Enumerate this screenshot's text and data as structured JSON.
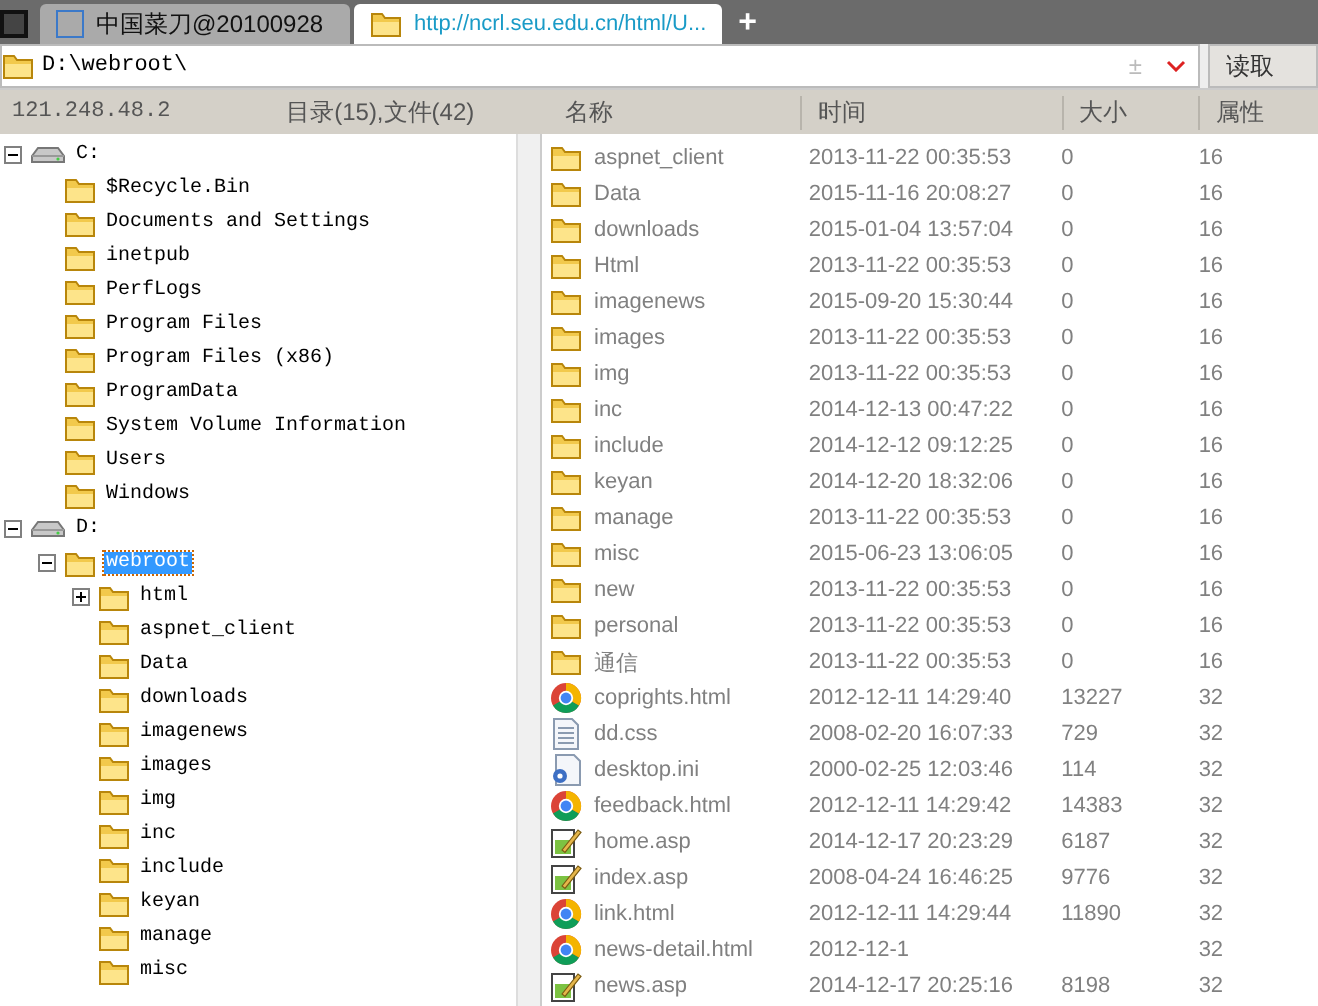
{
  "tabs": [
    {
      "label": "中国菜刀@20100928",
      "selected": false
    },
    {
      "label": "http://ncrl.seu.edu.cn/html/U...",
      "selected": true
    }
  ],
  "new_tab": "+",
  "address_bar": {
    "value": "D:\\webroot\\",
    "toggle": "±",
    "button": "读取"
  },
  "status": {
    "host": "121.248.48.2",
    "counts": "目录(15),文件(42)"
  },
  "columns": [
    "名称",
    "时间",
    "大小",
    "属性"
  ],
  "tree": [
    {
      "label": "C:",
      "kind": "drive",
      "expanded": true,
      "selected": false,
      "children": [
        {
          "label": "$Recycle.Bin",
          "kind": "folder",
          "selected": false
        },
        {
          "label": "Documents and Settings",
          "kind": "folder",
          "selected": false
        },
        {
          "label": "inetpub",
          "kind": "folder",
          "selected": false
        },
        {
          "label": "PerfLogs",
          "kind": "folder",
          "selected": false
        },
        {
          "label": "Program Files",
          "kind": "folder",
          "selected": false
        },
        {
          "label": "Program Files (x86)",
          "kind": "folder",
          "selected": false
        },
        {
          "label": "ProgramData",
          "kind": "folder",
          "selected": false
        },
        {
          "label": "System Volume Information",
          "kind": "folder",
          "selected": false
        },
        {
          "label": "Users",
          "kind": "folder",
          "selected": false
        },
        {
          "label": "Windows",
          "kind": "folder",
          "selected": false
        }
      ]
    },
    {
      "label": "D:",
      "kind": "drive",
      "expanded": true,
      "selected": false,
      "children": [
        {
          "label": "webroot",
          "kind": "folder",
          "expanded": true,
          "selected": true,
          "children": [
            {
              "label": "html",
              "kind": "folder",
              "expanded": false,
              "selected": false
            },
            {
              "label": "aspnet_client",
              "kind": "folder",
              "selected": false
            },
            {
              "label": "Data",
              "kind": "folder",
              "selected": false
            },
            {
              "label": "downloads",
              "kind": "folder",
              "selected": false
            },
            {
              "label": "imagenews",
              "kind": "folder",
              "selected": false
            },
            {
              "label": "images",
              "kind": "folder",
              "selected": false
            },
            {
              "label": "img",
              "kind": "folder",
              "selected": false
            },
            {
              "label": "inc",
              "kind": "folder",
              "selected": false
            },
            {
              "label": "include",
              "kind": "folder",
              "selected": false
            },
            {
              "label": "keyan",
              "kind": "folder",
              "selected": false
            },
            {
              "label": "manage",
              "kind": "folder",
              "selected": false
            },
            {
              "label": "misc",
              "kind": "folder",
              "selected": false
            }
          ]
        }
      ]
    }
  ],
  "files": [
    {
      "kind": "folder",
      "name": "aspnet_client",
      "time": "2013-11-22 00:35:53",
      "size": "0",
      "attr": "16"
    },
    {
      "kind": "folder",
      "name": "Data",
      "time": "2015-11-16 20:08:27",
      "size": "0",
      "attr": "16"
    },
    {
      "kind": "folder",
      "name": "downloads",
      "time": "2015-01-04 13:57:04",
      "size": "0",
      "attr": "16"
    },
    {
      "kind": "folder",
      "name": "Html",
      "time": "2013-11-22 00:35:53",
      "size": "0",
      "attr": "16"
    },
    {
      "kind": "folder",
      "name": "imagenews",
      "time": "2015-09-20 15:30:44",
      "size": "0",
      "attr": "16"
    },
    {
      "kind": "folder",
      "name": "images",
      "time": "2013-11-22 00:35:53",
      "size": "0",
      "attr": "16"
    },
    {
      "kind": "folder",
      "name": "img",
      "time": "2013-11-22 00:35:53",
      "size": "0",
      "attr": "16"
    },
    {
      "kind": "folder",
      "name": "inc",
      "time": "2014-12-13 00:47:22",
      "size": "0",
      "attr": "16"
    },
    {
      "kind": "folder",
      "name": "include",
      "time": "2014-12-12 09:12:25",
      "size": "0",
      "attr": "16"
    },
    {
      "kind": "folder",
      "name": "keyan",
      "time": "2014-12-20 18:32:06",
      "size": "0",
      "attr": "16"
    },
    {
      "kind": "folder",
      "name": "manage",
      "time": "2013-11-22 00:35:53",
      "size": "0",
      "attr": "16"
    },
    {
      "kind": "folder",
      "name": "misc",
      "time": "2015-06-23 13:06:05",
      "size": "0",
      "attr": "16"
    },
    {
      "kind": "folder",
      "name": "new",
      "time": "2013-11-22 00:35:53",
      "size": "0",
      "attr": "16"
    },
    {
      "kind": "folder",
      "name": "personal",
      "time": "2013-11-22 00:35:53",
      "size": "0",
      "attr": "16"
    },
    {
      "kind": "folder",
      "name": "通信",
      "time": "2013-11-22 00:35:53",
      "size": "0",
      "attr": "16"
    },
    {
      "kind": "html",
      "name": "coprights.html",
      "time": "2012-12-11 14:29:40",
      "size": "13227",
      "attr": "32"
    },
    {
      "kind": "text",
      "name": "dd.css",
      "time": "2008-02-20 16:07:33",
      "size": "729",
      "attr": "32"
    },
    {
      "kind": "ini",
      "name": "desktop.ini",
      "time": "2000-02-25 12:03:46",
      "size": "114",
      "attr": "32"
    },
    {
      "kind": "html",
      "name": "feedback.html",
      "time": "2012-12-11 14:29:42",
      "size": "14383",
      "attr": "32"
    },
    {
      "kind": "asp",
      "name": "home.asp",
      "time": "2014-12-17 20:23:29",
      "size": "6187",
      "attr": "32"
    },
    {
      "kind": "asp",
      "name": "index.asp",
      "time": "2008-04-24 16:46:25",
      "size": "9776",
      "attr": "32"
    },
    {
      "kind": "html",
      "name": "link.html",
      "time": "2012-12-11 14:29:44",
      "size": "11890",
      "attr": "32"
    },
    {
      "kind": "html",
      "name": "news-detail.html",
      "time": "2012-12-1",
      "attr": "32"
    },
    {
      "kind": "asp",
      "name": "news.asp",
      "time": "2014-12-17 20:25:16",
      "size": "8198",
      "attr": "32"
    }
  ]
}
